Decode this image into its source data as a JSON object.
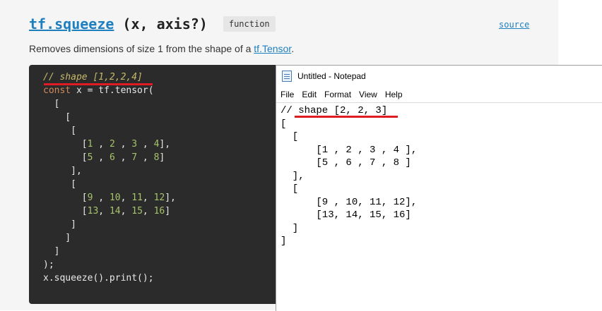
{
  "doc": {
    "function_name": "tf.squeeze",
    "signature": "(x, axis?)",
    "badge": "function",
    "source_label": "source",
    "description_prefix": "Removes dimensions of size 1 from the shape of a ",
    "description_link": "tf.Tensor",
    "description_suffix": "."
  },
  "code_block": {
    "comment": "// shape [1,2,2,4]",
    "line2_kw": "const",
    "line2_rest": " x = tf.tensor(",
    "lines": [
      "  [",
      "    [",
      "     [",
      "       [1 , 2 , 3 , 4],",
      "       [5 , 6 , 7 , 8]",
      "     ],",
      "     [",
      "       [9 , 10, 11, 12],",
      "       [13, 14, 15, 16]",
      "     ]",
      "    ]",
      "  ]",
      ");",
      "x.squeeze().print();"
    ],
    "highlight_color": "#e01b24"
  },
  "notepad": {
    "title": "Untitled - Notepad",
    "menu": [
      "File",
      "Edit",
      "Format",
      "View",
      "Help"
    ],
    "text_lines": [
      "// shape [2, 2, 3]",
      "[",
      "  [",
      "      [1 , 2 , 3 , 4 ],",
      "      [5 , 6 , 7 , 8 ]",
      "  ],",
      "  [",
      "      [9 , 10, 11, 12],",
      "      [13, 14, 15, 16]",
      "  ]",
      "]"
    ]
  }
}
